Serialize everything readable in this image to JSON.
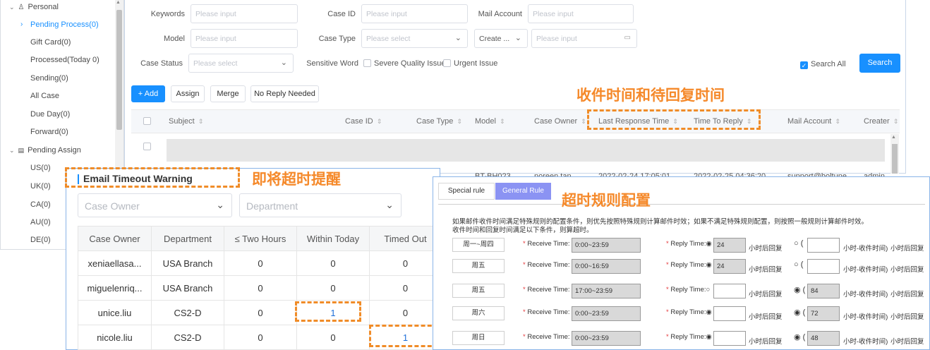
{
  "sidebar": {
    "group_personal": "Personal",
    "personal_items": [
      "Pending Process(0)",
      "Gift Card(0)",
      "Processed(Today 0)",
      "Sending(0)",
      "All Case",
      "Due Day(0)",
      "Forward(0)"
    ],
    "group_pending_assign": "Pending Assign",
    "assign_items": [
      "US(0)",
      "UK(0)",
      "CA(0)",
      "AU(0)",
      "DE(0)"
    ]
  },
  "filters": {
    "keywords_label": "Keywords",
    "keywords_placeholder": "Please input",
    "caseid_label": "Case ID",
    "caseid_placeholder": "Please input",
    "mailaccount_label": "Mail Account",
    "mailaccount_placeholder": "Please input",
    "model_label": "Model",
    "model_placeholder": "Please input",
    "casetype_label": "Case Type",
    "casetype_placeholder": "Please select",
    "create_select": "Create ...",
    "date_placeholder": "Please input",
    "casestatus_label": "Case Status",
    "casestatus_placeholder": "Please select",
    "sensitive_label": "Sensitive Word",
    "severe_label": "Severe Quality Issue",
    "urgent_label": "Urgent Issue",
    "search_all_label": "Search All",
    "search_button": "Search"
  },
  "toolbar": {
    "add": "+ Add",
    "assign": "Assign",
    "merge": "Merge",
    "no_reply": "No Reply Needed"
  },
  "table": {
    "columns": [
      "Subject",
      "Case ID",
      "Case Type",
      "Model",
      "Case Owner",
      "Last Response Time",
      "Time To Reply",
      "Mail Account",
      "Creater"
    ],
    "peek_row": [
      "BT-BH023",
      "noreen.tan",
      "2022-02-24 17:05:01",
      "2022-02-25 04:36:20",
      "support@boltune",
      "admin"
    ]
  },
  "annotations": {
    "receive_reply": "收件时间和待回复时间",
    "timeout_warning": "即将超时提醒",
    "rule_config": "超时规则配置"
  },
  "email_timeout": {
    "title": "Email Timeout Warning",
    "owner_placeholder": "Case Owner",
    "department_placeholder": "Department",
    "columns": [
      "Case Owner",
      "Department",
      "≤ Two Hours",
      "Within Today",
      "Timed Out"
    ],
    "rows": [
      [
        "xeniaellasa...",
        "USA Branch",
        "0",
        "0",
        "0"
      ],
      [
        "miguelenriq...",
        "USA Branch",
        "0",
        "0",
        "0"
      ],
      [
        "unice.liu",
        "CS2-D",
        "0",
        "1",
        "0"
      ],
      [
        "nicole.liu",
        "CS2-D",
        "0",
        "0",
        "1"
      ]
    ]
  },
  "rule_config": {
    "tabs": [
      "Special rule",
      "General Rule"
    ],
    "desc_line1": "如果邮件收件时间满足特殊规则的配置条件，则优先按照特殊规则计算邮件时效；如果不满足特殊规则配置，则按照一般规则计算邮件时效。",
    "desc_line2": "收件时间和回复时间满足以下条件，则算超时。",
    "receive_label": "Receive Time:",
    "reply_label": "Reply Time:",
    "after_hours": "小时后回复",
    "minus_receive": "小时-收件时间)",
    "rows": [
      {
        "day": "周一~周四",
        "receive": "0:00~23:59",
        "reply": "24",
        "alt": ""
      },
      {
        "day": "周五",
        "receive": "0:00~16:59",
        "reply": "24",
        "alt": ""
      },
      {
        "day": "周五",
        "receive": "17:00~23:59",
        "reply": "",
        "alt": "84"
      },
      {
        "day": "周六",
        "receive": "0:00~23:59",
        "reply": "",
        "alt": "72"
      },
      {
        "day": "周日",
        "receive": "0:00~23:59",
        "reply": "",
        "alt": "48"
      }
    ]
  },
  "colors": {
    "accent": "#1890ff",
    "annotation": "#f08c28",
    "link": "#1e6fd9",
    "general_tab": "#8b93f3"
  }
}
